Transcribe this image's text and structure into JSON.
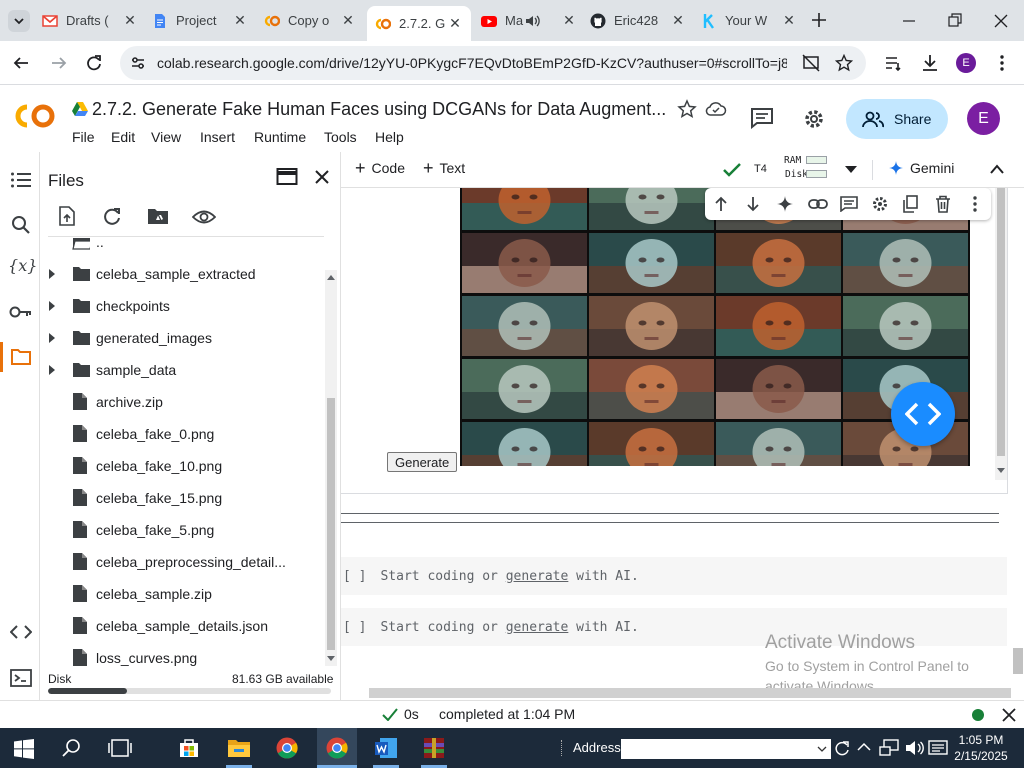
{
  "browser": {
    "tabs": [
      {
        "label": "Drafts (",
        "icon": "gmail-icon",
        "color": "#ea4335"
      },
      {
        "label": "Project",
        "icon": "docs-icon",
        "color": "#4285f4"
      },
      {
        "label": "Copy o",
        "icon": "colab-icon",
        "color": "#f9ab00"
      },
      {
        "label": "2.7.2. G",
        "icon": "colab-icon",
        "color": "#f9ab00",
        "active": true
      },
      {
        "label": "Ma",
        "icon": "youtube-icon",
        "color": "#ff0000"
      },
      {
        "label": "Eric428",
        "icon": "github-icon",
        "color": "#24292f"
      },
      {
        "label": "Your W",
        "icon": "kaggle-icon",
        "color": "#20beff"
      }
    ],
    "url": "colab.research.google.com/drive/12yYU-0PKygcF7EQvDtoBEmP2GfD-KzCV?authuser=0#scrollTo=j8i...",
    "profile_initial": "E"
  },
  "colab": {
    "title": "2.7.2. Generate Fake Human Faces using DCGANs for Data Augment...",
    "menu": [
      "File",
      "Edit",
      "View",
      "Insert",
      "Runtime",
      "Tools",
      "Help"
    ],
    "share_label": "Share",
    "user_initial": "E",
    "toolbar": {
      "code_label": "Code",
      "text_label": "Text",
      "runtime": "T4",
      "ram_label": "RAM",
      "disk_label": "Disk",
      "gemini_label": "Gemini"
    }
  },
  "files": {
    "title": "Files",
    "parent_label": "..",
    "items": [
      {
        "name": "celeba_sample_extracted",
        "type": "folder"
      },
      {
        "name": "checkpoints",
        "type": "folder"
      },
      {
        "name": "generated_images",
        "type": "folder"
      },
      {
        "name": "sample_data",
        "type": "folder"
      },
      {
        "name": "archive.zip",
        "type": "file"
      },
      {
        "name": "celeba_fake_0.png",
        "type": "file"
      },
      {
        "name": "celeba_fake_10.png",
        "type": "file"
      },
      {
        "name": "celeba_fake_15.png",
        "type": "file"
      },
      {
        "name": "celeba_fake_5.png",
        "type": "file"
      },
      {
        "name": "celeba_preprocessing_detail...",
        "type": "file"
      },
      {
        "name": "celeba_sample.zip",
        "type": "file"
      },
      {
        "name": "celeba_sample_details.json",
        "type": "file"
      },
      {
        "name": "loss_curves.png",
        "type": "file"
      }
    ],
    "disk_label": "Disk",
    "disk_available": "81.63 GB available",
    "disk_used_fraction": 0.28
  },
  "notebook": {
    "generate_button": "Generate",
    "empty_cells": [
      {
        "bracket": "[ ]",
        "before": "Start coding or ",
        "link": "generate",
        "after": " with AI."
      },
      {
        "bracket": "[ ]",
        "before": "Start coding or ",
        "link": "generate",
        "after": " with AI."
      }
    ],
    "watermark_title": "Activate Windows",
    "watermark_line1": "Go to System in Control Panel to",
    "watermark_line2": "activate Windows."
  },
  "status": {
    "duration": "0s",
    "message": "completed at 1:04 PM"
  },
  "taskbar": {
    "address_label": "Address",
    "time": "1:05 PM",
    "date": "2/15/2025"
  }
}
